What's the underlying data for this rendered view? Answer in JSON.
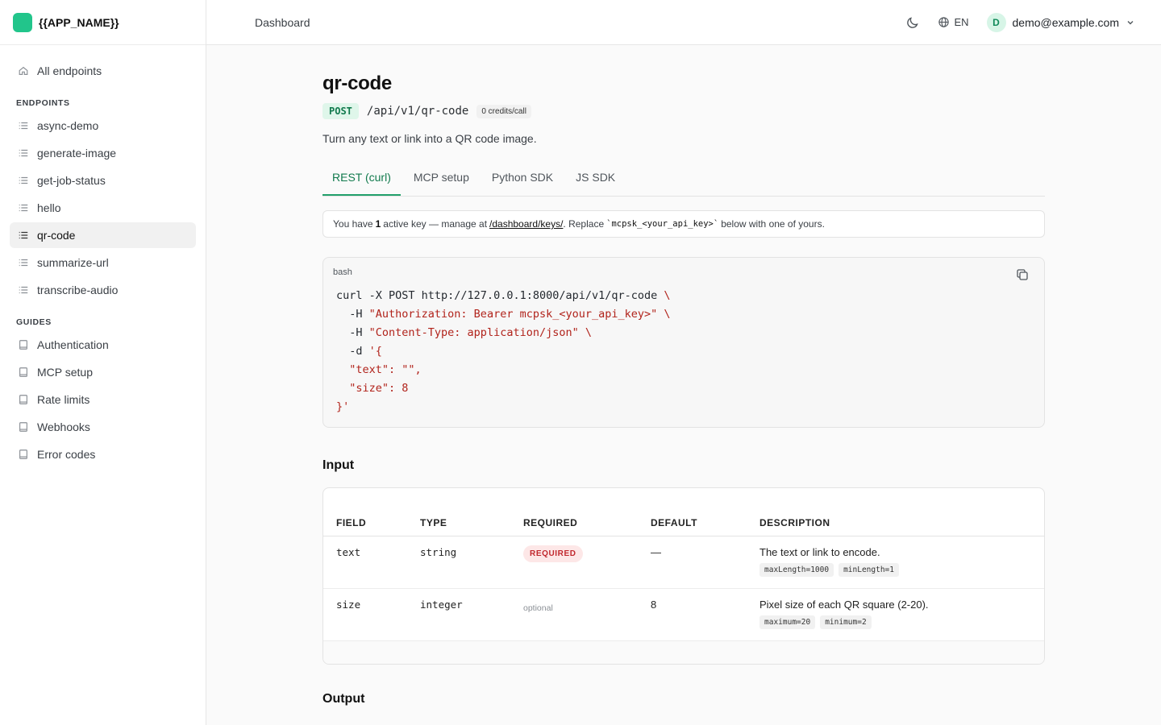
{
  "app": {
    "name": "{{APP_NAME}}",
    "brand_color": "#22c58b"
  },
  "sidebar": {
    "all_endpoints": "All endpoints",
    "endpoints_heading": "ENDPOINTS",
    "endpoints": [
      "async-demo",
      "generate-image",
      "get-job-status",
      "hello",
      "qr-code",
      "summarize-url",
      "transcribe-audio"
    ],
    "active_endpoint": "qr-code",
    "guides_heading": "GUIDES",
    "guides": [
      "Authentication",
      "MCP setup",
      "Rate limits",
      "Webhooks",
      "Error codes"
    ]
  },
  "topbar": {
    "breadcrumb": "Dashboard",
    "language": "EN",
    "user_initial": "D",
    "user_email": "demo@example.com"
  },
  "endpoint": {
    "title": "qr-code",
    "method": "POST",
    "path": "/api/v1/qr-code",
    "credits": "0 credits/call",
    "description": "Turn any text or link into a QR code image."
  },
  "tabs": [
    "REST (curl)",
    "MCP setup",
    "Python SDK",
    "JS SDK"
  ],
  "active_tab": "REST (curl)",
  "notice": {
    "prefix": "You have",
    "count": "1",
    "middle": "active key — manage at",
    "link": "/dashboard/keys/",
    "after_link": ". Replace",
    "key_placeholder": "`mcpsk_<your_api_key>`",
    "suffix": "below with one of yours."
  },
  "code": {
    "language": "bash",
    "line1_cmd": "curl -X POST http://127.0.0.1:8000/api/v1/qr-code ",
    "line1_cont": "\\",
    "line2_flag": "  -H ",
    "line2_str": "\"Authorization: Bearer mcpsk_<your_api_key>\"",
    "line2_cont": " \\",
    "line3_flag": "  -H ",
    "line3_str": "\"Content-Type: application/json\"",
    "line3_cont": " \\",
    "line4_flag": "  -d ",
    "line4_str": "'{",
    "line5_key": "  \"text\"",
    "line5_rest": ": \"\",",
    "line6_key": "  \"size\"",
    "line6_rest": ": 8",
    "line7_str": "}'"
  },
  "input": {
    "heading": "Input",
    "columns": [
      "FIELD",
      "TYPE",
      "REQUIRED",
      "DEFAULT",
      "DESCRIPTION"
    ],
    "rows": [
      {
        "field": "text",
        "type": "string",
        "required": "REQUIRED",
        "default": "—",
        "description": "The text or link to encode.",
        "chips": [
          "maxLength=1000",
          "minLength=1"
        ]
      },
      {
        "field": "size",
        "type": "integer",
        "required": "optional",
        "default": "8",
        "description": "Pixel size of each QR square (2-20).",
        "chips": [
          "maximum=20",
          "minimum=2"
        ]
      }
    ]
  },
  "output": {
    "heading": "Output"
  }
}
